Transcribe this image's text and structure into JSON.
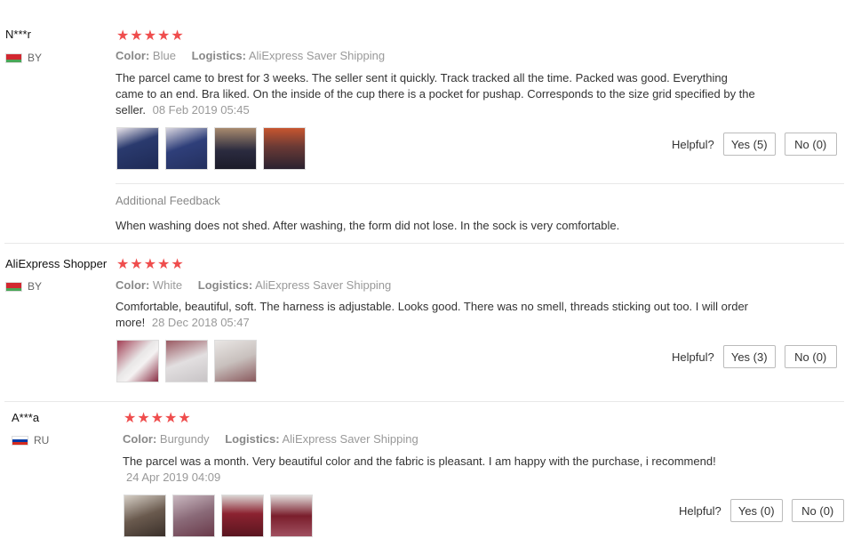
{
  "reviews": [
    {
      "user": "N***r",
      "country": "BY",
      "stars": "★★★★★",
      "color_label": "Color:",
      "color_value": "Blue",
      "logistics_label": "Logistics:",
      "logistics_value": "AliExpress Saver Shipping",
      "text": "The parcel came to brest for 3 weeks. The seller sent it quickly. Track tracked all the time. Packed was good. Everything came to an end. Bra liked. On the inside of the cup there is a pocket for pushap. Corresponds to the size grid specified by the seller.",
      "date": "08 Feb 2019 05:45",
      "helpful_label": "Helpful?",
      "yes_label": "Yes (5)",
      "no_label": "No (0)",
      "thumb_colors": [
        "#2a3a6e",
        "#2f3f7a",
        "#2b2b3f",
        "#6b3a35"
      ],
      "additional_title": "Additional Feedback",
      "additional_text": "When washing does not shed. After washing, the form did not lose. In the sock is very comfortable."
    },
    {
      "user": "AliExpress Shopper",
      "country": "BY",
      "stars": "★★★★★",
      "color_label": "Color:",
      "color_value": "White",
      "logistics_label": "Logistics:",
      "logistics_value": "AliExpress Saver Shipping",
      "text": "Comfortable, beautiful, soft. The harness is adjustable. Looks good. There was no smell, threads sticking out too. I will order more!",
      "date": "28 Dec 2018 05:47",
      "helpful_label": "Helpful?",
      "yes_label": "Yes (3)",
      "no_label": "No (0)",
      "thumb_colors": [
        "#b8a9ae",
        "#9b5a63",
        "#c8c0bd"
      ]
    },
    {
      "user": "A***a",
      "country": "RU",
      "stars": "★★★★★",
      "color_label": "Color:",
      "color_value": "Burgundy",
      "logistics_label": "Logistics:",
      "logistics_value": "AliExpress Saver Shipping",
      "text": "The parcel was a month. Very beautiful color and the fabric is pleasant. I am happy with the purchase, i recommend!",
      "date": "24 Apr 2019 04:09",
      "helpful_label": "Helpful?",
      "yes_label": "Yes (0)",
      "no_label": "No (0)",
      "thumb_colors": [
        "#6a5a4e",
        "#8a6a78",
        "#8c2230",
        "#7a1e2c"
      ]
    }
  ]
}
